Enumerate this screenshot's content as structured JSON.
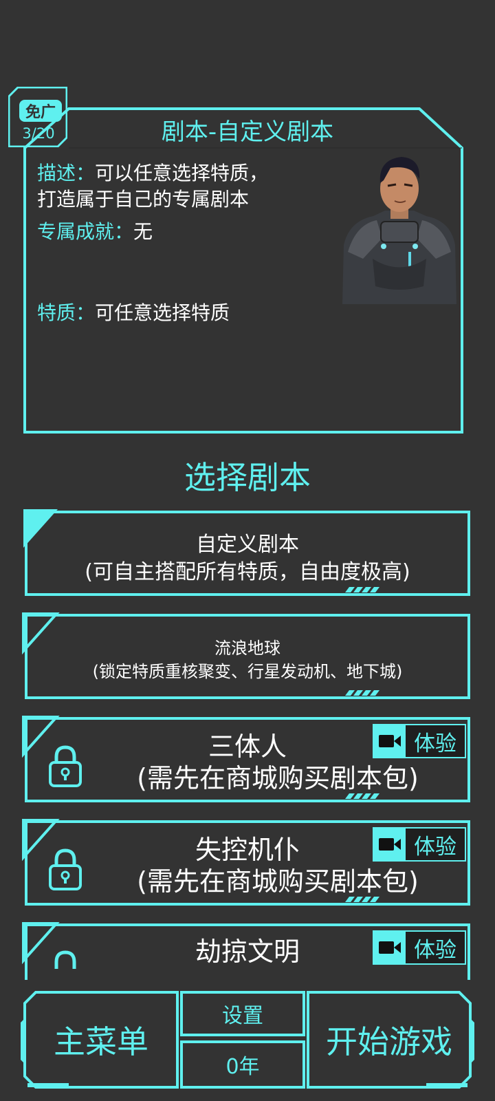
{
  "badge": {
    "label": "免广",
    "count": "3/20"
  },
  "info": {
    "title": "剧本-自定义剧本",
    "description_label": "描述：",
    "description_line1": "可以任意选择特质，",
    "description_line2": "打造属于自己的专属剧本",
    "achievement_label": "专属成就：",
    "achievement_value": "无",
    "traits_label": "特质：",
    "traits_value": "可任意选择特质"
  },
  "section_title": "选择剧本",
  "scripts": [
    {
      "title": "自定义剧本",
      "subtitle": "(可自主搭配所有特质，自由度极高)",
      "selected": true,
      "locked": false
    },
    {
      "title": "流浪地球",
      "subtitle": "(锁定特质重核聚变、行星发动机、地下城)",
      "selected": false,
      "locked": false
    },
    {
      "title": "三体人",
      "subtitle": "(需先在商城购买剧本包)",
      "locked": true,
      "trial": "体验"
    },
    {
      "title": "失控机仆",
      "subtitle": "(需先在商城购买剧本包)",
      "locked": true,
      "trial": "体验"
    },
    {
      "title": "劫掠文明",
      "locked": true,
      "trial": "体验"
    }
  ],
  "bottom": {
    "main_menu": "主菜单",
    "settings": "设置",
    "year": "0年",
    "start": "开始游戏"
  },
  "colors": {
    "accent": "#5ff0ef",
    "background": "#333333"
  }
}
